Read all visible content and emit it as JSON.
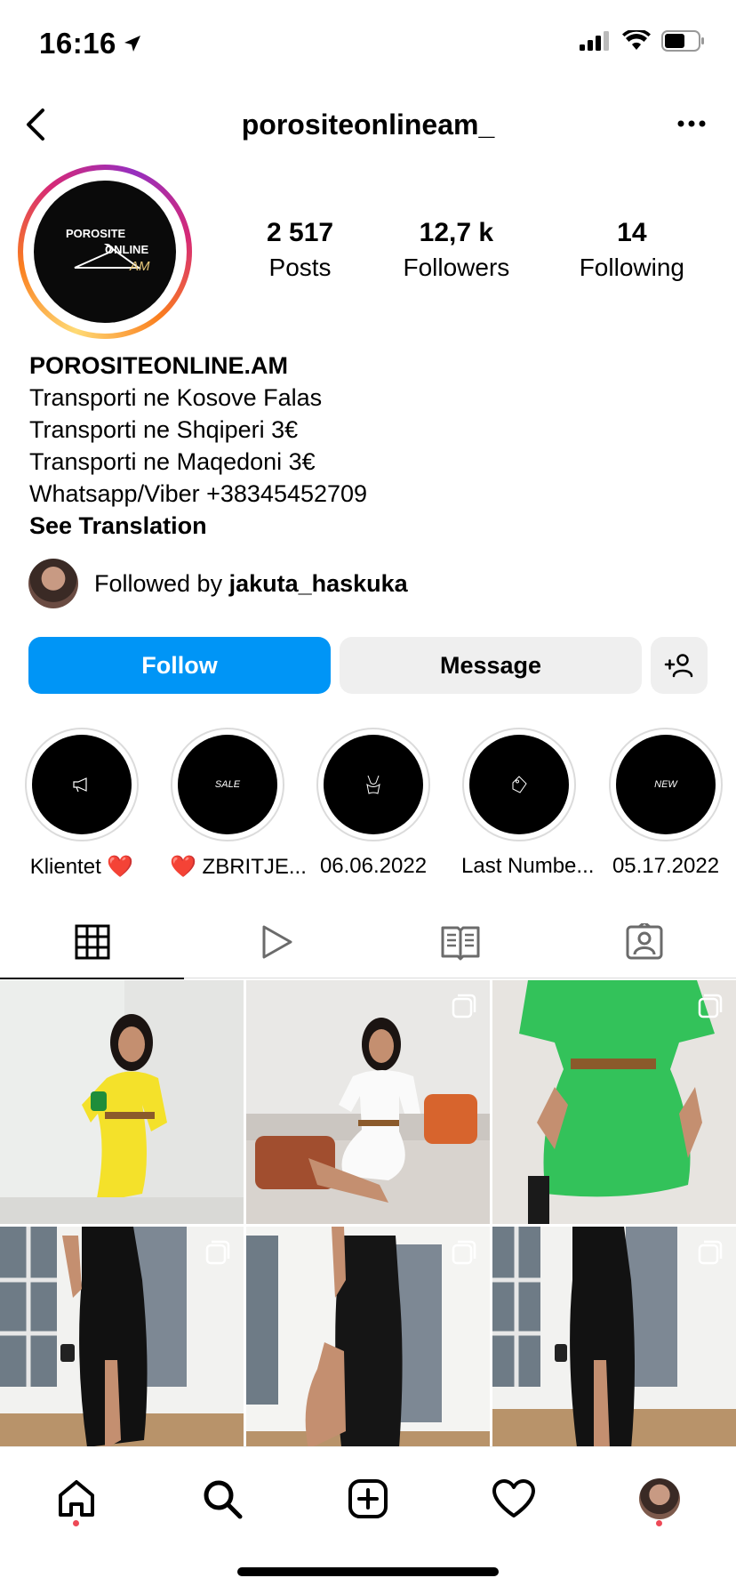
{
  "status_bar": {
    "time": "16:16"
  },
  "header": {
    "username": "porositeonlineam_"
  },
  "avatar": {
    "line1": "POROSITE",
    "line2": "ONLINE",
    "line3": "AM"
  },
  "stats": [
    {
      "value": "2 517",
      "label": "Posts"
    },
    {
      "value": "12,7 k",
      "label": "Followers"
    },
    {
      "value": "14",
      "label": "Following"
    }
  ],
  "bio": {
    "name": "POROSITEONLINE.AM",
    "lines": [
      "Transporti ne Kosove Falas",
      "Transporti ne Shqiperi 3€",
      "Transporti ne Maqedoni 3€",
      "Whatsapp/Viber +38345452709"
    ],
    "see_translation": "See Translation"
  },
  "followed_by": {
    "prefix": "Followed by ",
    "user": "jakuta_haskuka"
  },
  "buttons": {
    "follow": "Follow",
    "message": "Message"
  },
  "highlights": [
    {
      "label": "Klientet ❤️",
      "icon": "megaphone-icon",
      "mark": ""
    },
    {
      "label": "❤️ ZBRITJE...",
      "icon": "sale-icon",
      "mark": "SALE"
    },
    {
      "label": "06.06.2022",
      "icon": "swimsuit-icon",
      "mark": ""
    },
    {
      "label": "Last Numbe...",
      "icon": "tag-icon",
      "mark": ""
    },
    {
      "label": "05.17.2022",
      "icon": "new-icon",
      "mark": "NEW"
    }
  ],
  "tabs": [
    "grid-icon",
    "reels-icon",
    "guide-icon",
    "tagged-icon"
  ],
  "colors": {
    "follow_blue": "#0095f6",
    "button_gray": "#efefef",
    "notif_red": "#ed4956"
  },
  "posts": [
    {
      "dress": "yellow dress",
      "color": "#f4e12a",
      "multi": false
    },
    {
      "dress": "white dress",
      "color": "#ffffff",
      "multi": true
    },
    {
      "dress": "green dress",
      "color": "#33c25a",
      "multi": true
    },
    {
      "dress": "black dress",
      "color": "#111111",
      "multi": true
    },
    {
      "dress": "black dress",
      "color": "#151515",
      "multi": true
    },
    {
      "dress": "black dress",
      "color": "#121212",
      "multi": true
    }
  ]
}
